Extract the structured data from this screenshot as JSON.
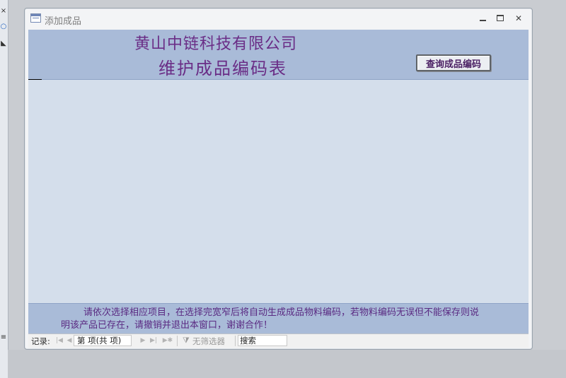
{
  "window": {
    "title": "添加成品",
    "controls": {
      "minimize": "minimize",
      "restore": "restore",
      "close": "✕"
    }
  },
  "header": {
    "company": "黄山中链科技有限公司",
    "form_title": "维护成品编码表",
    "query_button": "查询成品编码"
  },
  "footer": {
    "message": "请依次选择相应项目，在选择完宽窄后将自动生成成品物料编码，若物料编码无误但不能保存则说明该产品已存在，请撤销并退出本窗口，谢谢合作！"
  },
  "nav": {
    "label": "记录:",
    "first": "|◀",
    "prev": "◀",
    "record": "第  项(共  项)",
    "next": "▶",
    "last": "▶|",
    "new": "▶✱",
    "filter": "无筛选器",
    "search": "搜索"
  },
  "left_strip": {
    "items": [
      "×",
      "○",
      "◣",
      "≡"
    ]
  },
  "colors": {
    "header_bg": "#a9bbd8",
    "detail_bg": "#d4deeb",
    "title_text": "#6a2d86"
  }
}
